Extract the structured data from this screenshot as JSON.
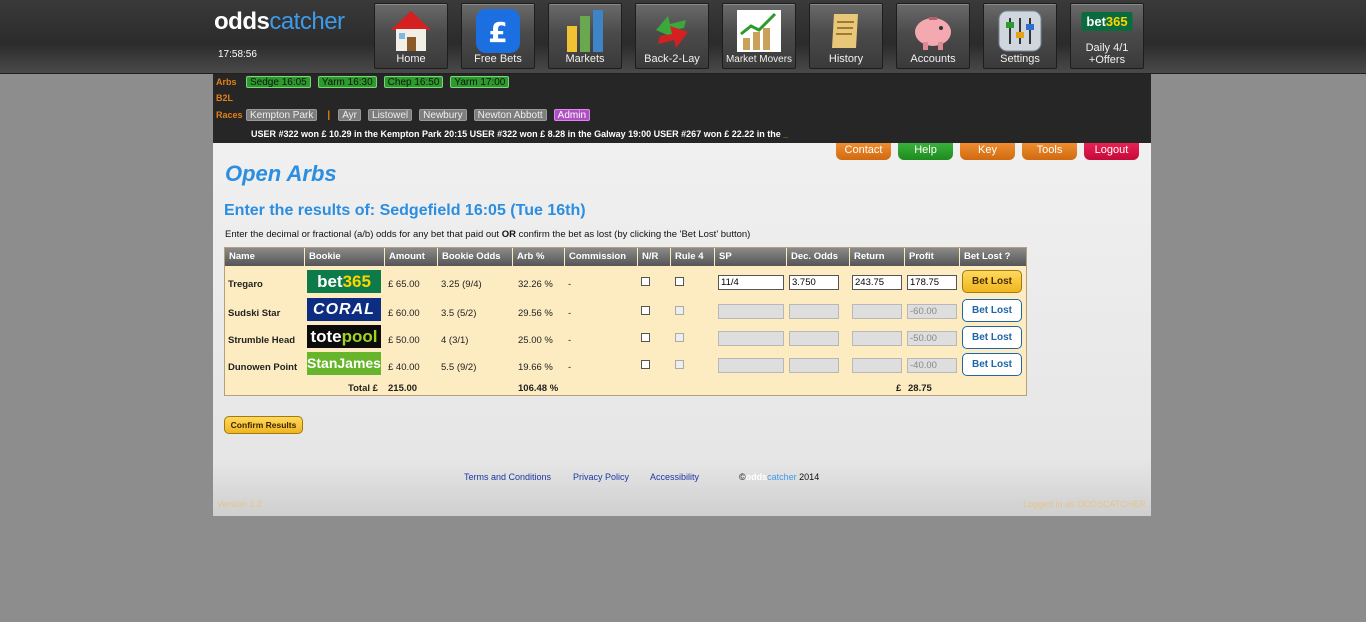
{
  "logo": {
    "part1": "odds",
    "part2": "catcher"
  },
  "clock": "17:58:56",
  "nav": [
    {
      "label": "Home",
      "icon": "house-icon"
    },
    {
      "label": "Free Bets",
      "icon": "pound-icon"
    },
    {
      "label": "Markets",
      "icon": "bar-chart-icon"
    },
    {
      "label": "Back-2-Lay",
      "icon": "arrows-icon"
    },
    {
      "label": "Market Movers",
      "icon": "trend-chart-icon"
    },
    {
      "label": "History",
      "icon": "scroll-icon"
    },
    {
      "label": "Accounts",
      "icon": "piggy-bank-icon"
    },
    {
      "label": "Settings",
      "icon": "sliders-icon"
    },
    {
      "label": "Daily 4/1",
      "label2": "+Offers",
      "logo": {
        "a": "bet",
        "b": "365"
      }
    }
  ],
  "arbs": {
    "label": "Arbs",
    "items": [
      "Sedge 16:05",
      "Yarm 16:30",
      "Chep 16:50",
      "Yarm 17:00"
    ]
  },
  "b2l": {
    "label": "B2L"
  },
  "races": {
    "label": "Races",
    "items": [
      "Kempton Park",
      "Ayr",
      "Listowel",
      "Newbury",
      "Newton Abbott"
    ],
    "admin": "Admin",
    "separator": "|"
  },
  "ticker": {
    "text": "USER #322 won £ 10.29 in the Kempton Park 20:15     USER #322 won £ 8.28 in the Galway 19:00     USER #267 won £ 22.22 in the",
    "cursor": "_"
  },
  "tabs": [
    "Contact",
    "Help",
    "Key",
    "Tools",
    "Logout"
  ],
  "title": "Open Arbs",
  "subtitle": "Enter the results of: Sedgefield 16:05 (Tue 16th)",
  "instructions": {
    "before": "Enter the decimal or fractional (a/b) odds for any bet that paid out ",
    "bold": "OR",
    "after": " confirm the bet as lost (by clicking the 'Bet Lost' button)"
  },
  "columns": [
    "Name",
    "Bookie",
    "Amount",
    "Bookie Odds",
    "Arb %",
    "Commission",
    "N/R",
    "Rule 4",
    "SP",
    "Dec. Odds",
    "Return",
    "Profit",
    "Bet Lost ?"
  ],
  "rows": [
    {
      "name": "Tregaro",
      "bookie": "bet365",
      "amount": "£ 65.00",
      "odds": "3.25 (9/4)",
      "arb": "32.26 %",
      "commission": "-",
      "sp": "11/4",
      "dec": "3.750",
      "ret": "243.75",
      "profit": "178.75",
      "bet_lost": "Bet Lost"
    },
    {
      "name": "Sudski Star",
      "bookie": "CORAL",
      "amount": "£ 60.00",
      "odds": "3.5 (5/2)",
      "arb": "29.56 %",
      "commission": "-",
      "sp": "",
      "dec": "",
      "ret": "",
      "profit": "-60.00",
      "bet_lost": "Bet Lost"
    },
    {
      "name": "Strumble Head",
      "bookie": "totepool",
      "amount": "£ 50.00",
      "odds": "4 (3/1)",
      "arb": "25.00 %",
      "commission": "-",
      "sp": "",
      "dec": "",
      "ret": "",
      "profit": "-50.00",
      "bet_lost": "Bet Lost"
    },
    {
      "name": "Dunowen Point",
      "bookie": "StanJames",
      "amount": "£ 40.00",
      "odds": "5.5 (9/2)",
      "arb": "19.66 %",
      "commission": "-",
      "sp": "",
      "dec": "",
      "ret": "",
      "profit": "-40.00",
      "bet_lost": "Bet Lost"
    }
  ],
  "totals": {
    "label": "Total £",
    "amount": "215.00",
    "arb": "106.48 %",
    "profit_symbol": "£",
    "profit": "28.75"
  },
  "confirm": "Confirm Results",
  "footer": {
    "terms": "Terms and Conditions",
    "privacy": "Privacy Policy",
    "access": "Accessibility",
    "copy_symbol": "©",
    "copy_year": "2014"
  },
  "version": "Version 1.2",
  "logged_in": "Logged in as ODDSCATCHER"
}
